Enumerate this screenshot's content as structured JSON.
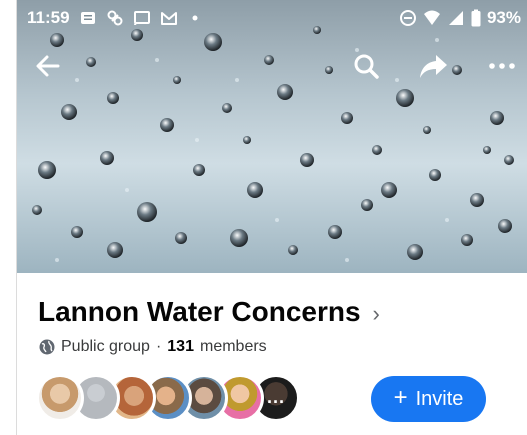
{
  "status_bar": {
    "time": "11:59",
    "left_icons": [
      "notification-icon",
      "app-icon",
      "cast-icon",
      "gmail-icon",
      "dot-icon"
    ],
    "right_icons": [
      "do-not-disturb-icon",
      "wifi-icon",
      "signal-icon",
      "battery-icon"
    ],
    "battery_text": "93%"
  },
  "toolbar": {
    "back_icon": "back-arrow-icon",
    "search_icon": "search-icon",
    "share_icon": "share-icon",
    "more_icon": "more-icon"
  },
  "group": {
    "name": "Lannon Water Concerns",
    "chevron": "›",
    "privacy": "Public group",
    "separator": "·",
    "member_count": "131",
    "member_label": "members"
  },
  "members_preview": {
    "avatar_count": 7,
    "overflow_label": "···"
  },
  "invite_button": {
    "plus": "+",
    "label": "Invite"
  },
  "colors": {
    "accent": "#1877f2",
    "text_primary": "#050505",
    "text_secondary": "#65676b"
  }
}
